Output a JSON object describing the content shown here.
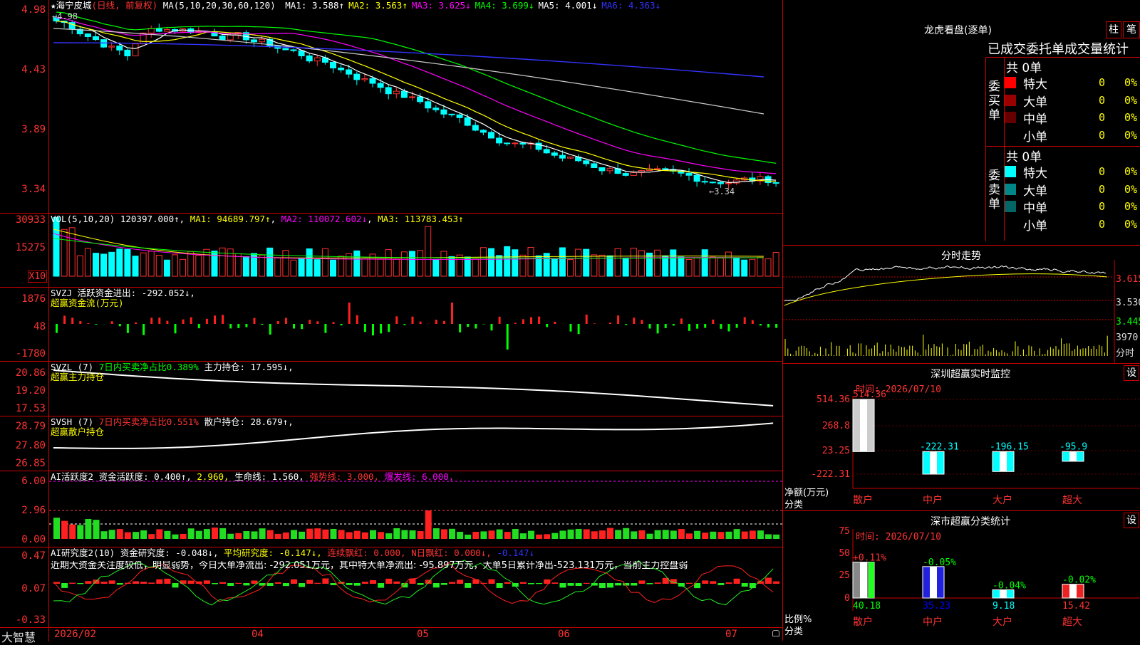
{
  "app": {
    "brand": "大智慧"
  },
  "main": {
    "title": "海宁皮城",
    "mode": "(日线, 前复权)",
    "ma_params": "MA(5,10,20,30,60,120)",
    "ma_values": [
      {
        "name": "MA1:",
        "value": "3.588↑",
        "color": "#ffffff"
      },
      {
        "name": "MA2:",
        "value": "3.563↑",
        "color": "#ffff00"
      },
      {
        "name": "MA3:",
        "value": "3.625↓",
        "color": "#ff00ff"
      },
      {
        "name": "MA4:",
        "value": "3.699↓",
        "color": "#00ff00"
      },
      {
        "name": "MA5:",
        "value": "4.001↓",
        "color": "#ffffff"
      },
      {
        "name": "MA6:",
        "value": "4.363↓",
        "color": "#3333ff"
      }
    ],
    "high_marker": "←4.98",
    "low_marker": "←3.34",
    "yticks": [
      "4.98",
      "4.43",
      "3.89",
      "3.34"
    ]
  },
  "vol": {
    "label": "VOL(5,10,20)",
    "value": "120397.000↑",
    "ma1": "MA1: 94689.797↑",
    "ma2": "MA2: 110072.602↓",
    "ma3": "MA3: 113783.453↑",
    "yticks": [
      "30933",
      "15275"
    ],
    "unit": "X10"
  },
  "svzj": {
    "label": "SVZJ",
    "line1": "活跃资金进出: -292.052↓,",
    "line2": "超赢资金流(万元)",
    "yticks": [
      "1876",
      "48",
      "-1780"
    ]
  },
  "svzl": {
    "label": "SVZL (7)",
    "ratio": "7日内买卖净占比0.389%",
    "hold": "主力持仓: 17.595↓,",
    "line2": "超赢主力持仓",
    "yticks": [
      "20.86",
      "19.20",
      "17.53"
    ]
  },
  "svsh": {
    "label": "SVSH (7)",
    "ratio": "7日内买卖净占比0.551%",
    "hold": "散户持仓: 28.679↑,",
    "line2": "超赢散户持仓",
    "yticks": [
      "28.79",
      "27.80",
      "26.85"
    ]
  },
  "ai1": {
    "label": "AI活跃度2",
    "activity": "资金活跃度: 0.400↑,",
    "v2": "2.960,",
    "life": "生命线: 1.560,",
    "strong": "强势线: 3.000,",
    "burst": "爆发线: 6.000,",
    "yticks": [
      "6.00",
      "2.96",
      "0.00"
    ]
  },
  "ai2": {
    "label": "AI研究度2(10)",
    "research": "资金研究度: -0.048↓,",
    "avg": "平均研究度: -0.147↓,",
    "red": "连续飘红: 0.000,",
    "nred": "N日飘红: 0.000↓,",
    "last": "-0.147↓",
    "summary": "近期大资金关注度较低，明显弱势，今日大单净流出: -292.051万元，其中特大单净流出: -95.897万元，大单5日累计净出-523.131万元，当前主力控盘弱",
    "yticks": [
      "0.47",
      "0.07",
      "-0.33"
    ]
  },
  "xaxis": [
    "2026/02",
    "04",
    "05",
    "06",
    "07"
  ],
  "right": {
    "longhu": {
      "title": "龙虎看盘(逐单)",
      "btn_zhu": "柱",
      "btn_bi": "笔",
      "tabs": "已成交委托单成交量统计",
      "buy_label": "委买单",
      "sell_label": "委卖单",
      "buy_total": "共 0单",
      "sell_total": "共 0单",
      "buy_rows": [
        {
          "name": "特大",
          "count": "0",
          "pct": "0%",
          "color": "#ff0000"
        },
        {
          "name": "大单",
          "count": "0",
          "pct": "0%",
          "color": "#990000"
        },
        {
          "name": "中单",
          "count": "0",
          "pct": "0%",
          "color": "#660000"
        },
        {
          "name": "小单",
          "count": "0",
          "pct": "0%",
          "color": "#000000"
        }
      ],
      "sell_rows": [
        {
          "name": "特大",
          "count": "0",
          "pct": "0%",
          "color": "#00ffff"
        },
        {
          "name": "大单",
          "count": "0",
          "pct": "0%",
          "color": "#008888"
        },
        {
          "name": "中单",
          "count": "0",
          "pct": "0%",
          "color": "#006666"
        },
        {
          "name": "小单",
          "count": "0",
          "pct": "0%",
          "color": "#000000"
        }
      ]
    },
    "fenshi": {
      "title": "分时走势",
      "yticks": [
        "3.615",
        "3.530",
        "3.445"
      ],
      "vol_tick": "3970",
      "vol_unit": "分时"
    },
    "sz_monitor": {
      "title": "深圳超赢实时监控",
      "set": "设",
      "time": "时间: 2026/07/10",
      "yticks": [
        "514.36",
        "268.8",
        "23.25",
        "-222.31"
      ],
      "ylabel": "净额(万元)",
      "xlabel": "分类",
      "bars": [
        {
          "cat": "散户",
          "label": "514.36",
          "value": 514.36
        },
        {
          "cat": "中户",
          "label": "-222.31",
          "value": -222.31
        },
        {
          "cat": "大户",
          "label": "-196.15",
          "value": -196.15
        },
        {
          "cat": "超大",
          "label": "-95.9",
          "value": -95.9
        }
      ]
    },
    "sz_class": {
      "title": "深市超赢分类统计",
      "set": "设",
      "time": "时间: 2026/07/10",
      "yticks": [
        "75",
        "50",
        "25",
        "0"
      ],
      "ylabel": "比例%",
      "xlabel": "分类",
      "bars": [
        {
          "cat": "散户",
          "top": "+0.11%",
          "bottom": "40.18",
          "value": 40.18
        },
        {
          "cat": "中户",
          "top": "-0.05%",
          "bottom": "35.23",
          "value": 35.23
        },
        {
          "cat": "大户",
          "top": "-0.04%",
          "bottom": "9.18",
          "value": 9.18
        },
        {
          "cat": "超大",
          "top": "-0.02%",
          "bottom": "15.42",
          "value": 15.42
        }
      ]
    }
  }
}
